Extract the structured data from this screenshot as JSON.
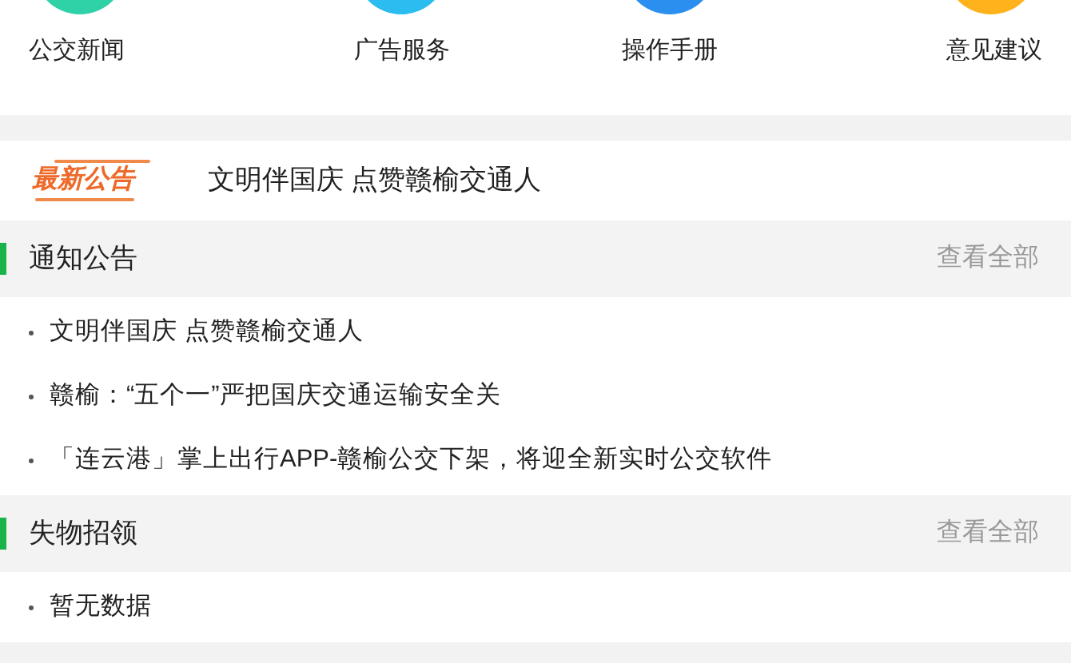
{
  "shortcuts": [
    {
      "label": "公交新闻",
      "color": "#2fd1a6"
    },
    {
      "label": "广告服务",
      "color": "#2bbcf0"
    },
    {
      "label": "操作手册",
      "color": "#2b8ff0"
    },
    {
      "label": "意见建议",
      "color": "#ffb21c"
    }
  ],
  "headline": {
    "badge": "最新公告",
    "text": "文明伴国庆 点赞赣榆交通人"
  },
  "sections": [
    {
      "title": "通知公告",
      "more": "查看全部",
      "items": [
        "文明伴国庆 点赞赣榆交通人",
        "赣榆：“五个一”严把国庆交通运输安全关",
        "「连云港」掌上出行APP-赣榆公交下架，将迎全新实时公交软件"
      ]
    },
    {
      "title": "失物招领",
      "more": "查看全部",
      "items": [
        "暂无数据"
      ]
    }
  ]
}
